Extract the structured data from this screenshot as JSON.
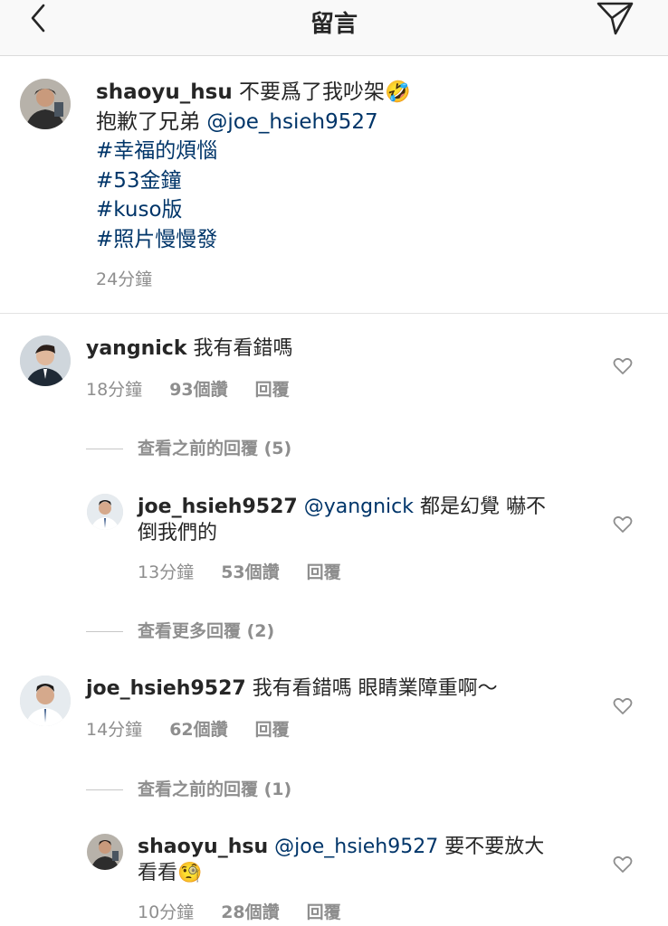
{
  "header": {
    "title": "留言",
    "back_icon": "chevron-left-icon",
    "send_icon": "paper-plane-icon"
  },
  "caption": {
    "username": "shaoyu_hsu",
    "text_1": "不要爲了我吵架🤣",
    "text_2": "抱歉了兄弟 ",
    "mention": "@joe_hsieh9527",
    "hashtags": [
      "#幸福的煩惱",
      "#53金鐘",
      "#kuso版",
      "#照片慢慢發"
    ],
    "time": "24分鐘"
  },
  "comments": [
    {
      "username": "yangnick",
      "text": "我有看錯嗎",
      "time": "18分鐘",
      "likes": "93個讚",
      "reply": "回覆",
      "view_replies": "查看之前的回覆 (5)",
      "replies": [
        {
          "username": "joe_hsieh9527",
          "mention": "@yangnick",
          "text_1": " 都是幻覺 嚇不",
          "text_2": "倒我們的",
          "time": "13分鐘",
          "likes": "53個讚",
          "reply": "回覆"
        }
      ],
      "view_more": "查看更多回覆 (2)"
    },
    {
      "username": "joe_hsieh9527",
      "text": "我有看錯嗎 眼睛業障重啊～",
      "time": "14分鐘",
      "likes": "62個讚",
      "reply": "回覆",
      "view_replies": "查看之前的回覆 (1)",
      "replies": [
        {
          "username": "shaoyu_hsu",
          "mention": "@joe_hsieh9527",
          "text_1": " 要不要放大",
          "text_2": "看看🧐",
          "time": "10分鐘",
          "likes": "28個讚",
          "reply": "回覆"
        }
      ]
    }
  ],
  "colors": {
    "link": "#003569",
    "meta": "#8e8e8e",
    "text": "#262626",
    "header_bg": "#f9f9f9"
  }
}
